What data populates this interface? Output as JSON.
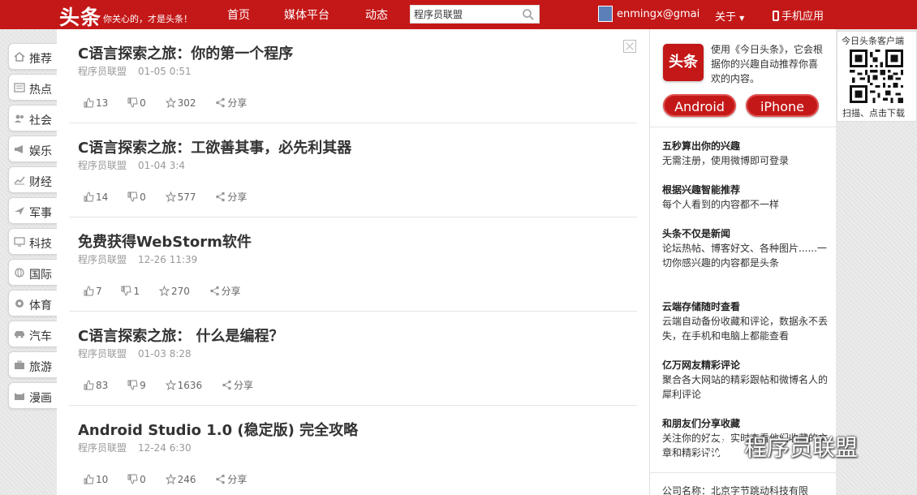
{
  "header": {
    "logo": "头条",
    "slogan": "你关心的，才是头条！",
    "nav": [
      "首页",
      "媒体平台",
      "动态"
    ],
    "search_value": "程序员联盟",
    "user_name": "enmingx@gmail",
    "about": "关于",
    "mobile": "手机应用"
  },
  "sidebar": {
    "items": [
      "推荐",
      "热点",
      "社会",
      "娱乐",
      "财经",
      "军事",
      "科技",
      "国际",
      "体育",
      "汽车",
      "旅游",
      "漫画"
    ]
  },
  "feed": {
    "articles": [
      {
        "title": "C语言探索之旅：你的第一个程序",
        "source": "程序员联盟",
        "time": "01-05 0:51",
        "likes": "13",
        "dislikes": "0",
        "favorites": "302",
        "share": "分享"
      },
      {
        "title": "C语言探索之旅：工欲善其事，必先利其器",
        "source": "程序员联盟",
        "time": "01-04 3:4",
        "likes": "14",
        "dislikes": "0",
        "favorites": "577",
        "share": "分享"
      },
      {
        "title": "免费获得WebStorm软件",
        "source": "程序员联盟",
        "time": "12-26 11:39",
        "likes": "7",
        "dislikes": "1",
        "favorites": "270",
        "share": "分享"
      },
      {
        "title": "C语言探索之旅： 什么是编程？",
        "source": "程序员联盟",
        "time": "01-03 8:28",
        "likes": "83",
        "dislikes": "9",
        "favorites": "1636",
        "share": "分享"
      },
      {
        "title": "Android Studio 1.0 (稳定版) 完全攻略",
        "source": "程序员联盟",
        "time": "12-24 6:30",
        "likes": "10",
        "dislikes": "0",
        "favorites": "246",
        "share": "分享"
      }
    ]
  },
  "right": {
    "app_logo": "头条",
    "app_desc": "使用《今日头条》，它会根据你的兴趣自动推荐你喜欢的内容。",
    "android": "Android",
    "iphone": "iPhone",
    "features": [
      {
        "title": "五秒算出你的兴趣",
        "desc": "无需注册，使用微博即可登录"
      },
      {
        "title": "根据兴趣智能推荐",
        "desc": "每个人看到的内容都不一样"
      },
      {
        "title": "头条不仅是新闻",
        "desc": "论坛热帖、博客好文、各种图片......一切你感兴趣的内容都是头条"
      },
      {
        "title": "云端存储随时查看",
        "desc": "云端自动备份收藏和评论，数据永不丢失，在手机和电脑上都能查看"
      },
      {
        "title": "亿万网友精彩评论",
        "desc": "聚合各大网站的精彩跟帖和微博名人的犀利评论"
      },
      {
        "title": "和朋友们分享收藏",
        "desc": "关注你的好友，实时查看他们收藏的文章和精彩评论"
      }
    ],
    "company": "公司名称：北京字节跳动科技有限"
  },
  "qr": {
    "title": "今日头条客户端",
    "caption": "扫描、点击下载"
  },
  "watermark": {
    "text": "程序员联盟"
  },
  "colors": {
    "brand_red": "#c41818"
  }
}
